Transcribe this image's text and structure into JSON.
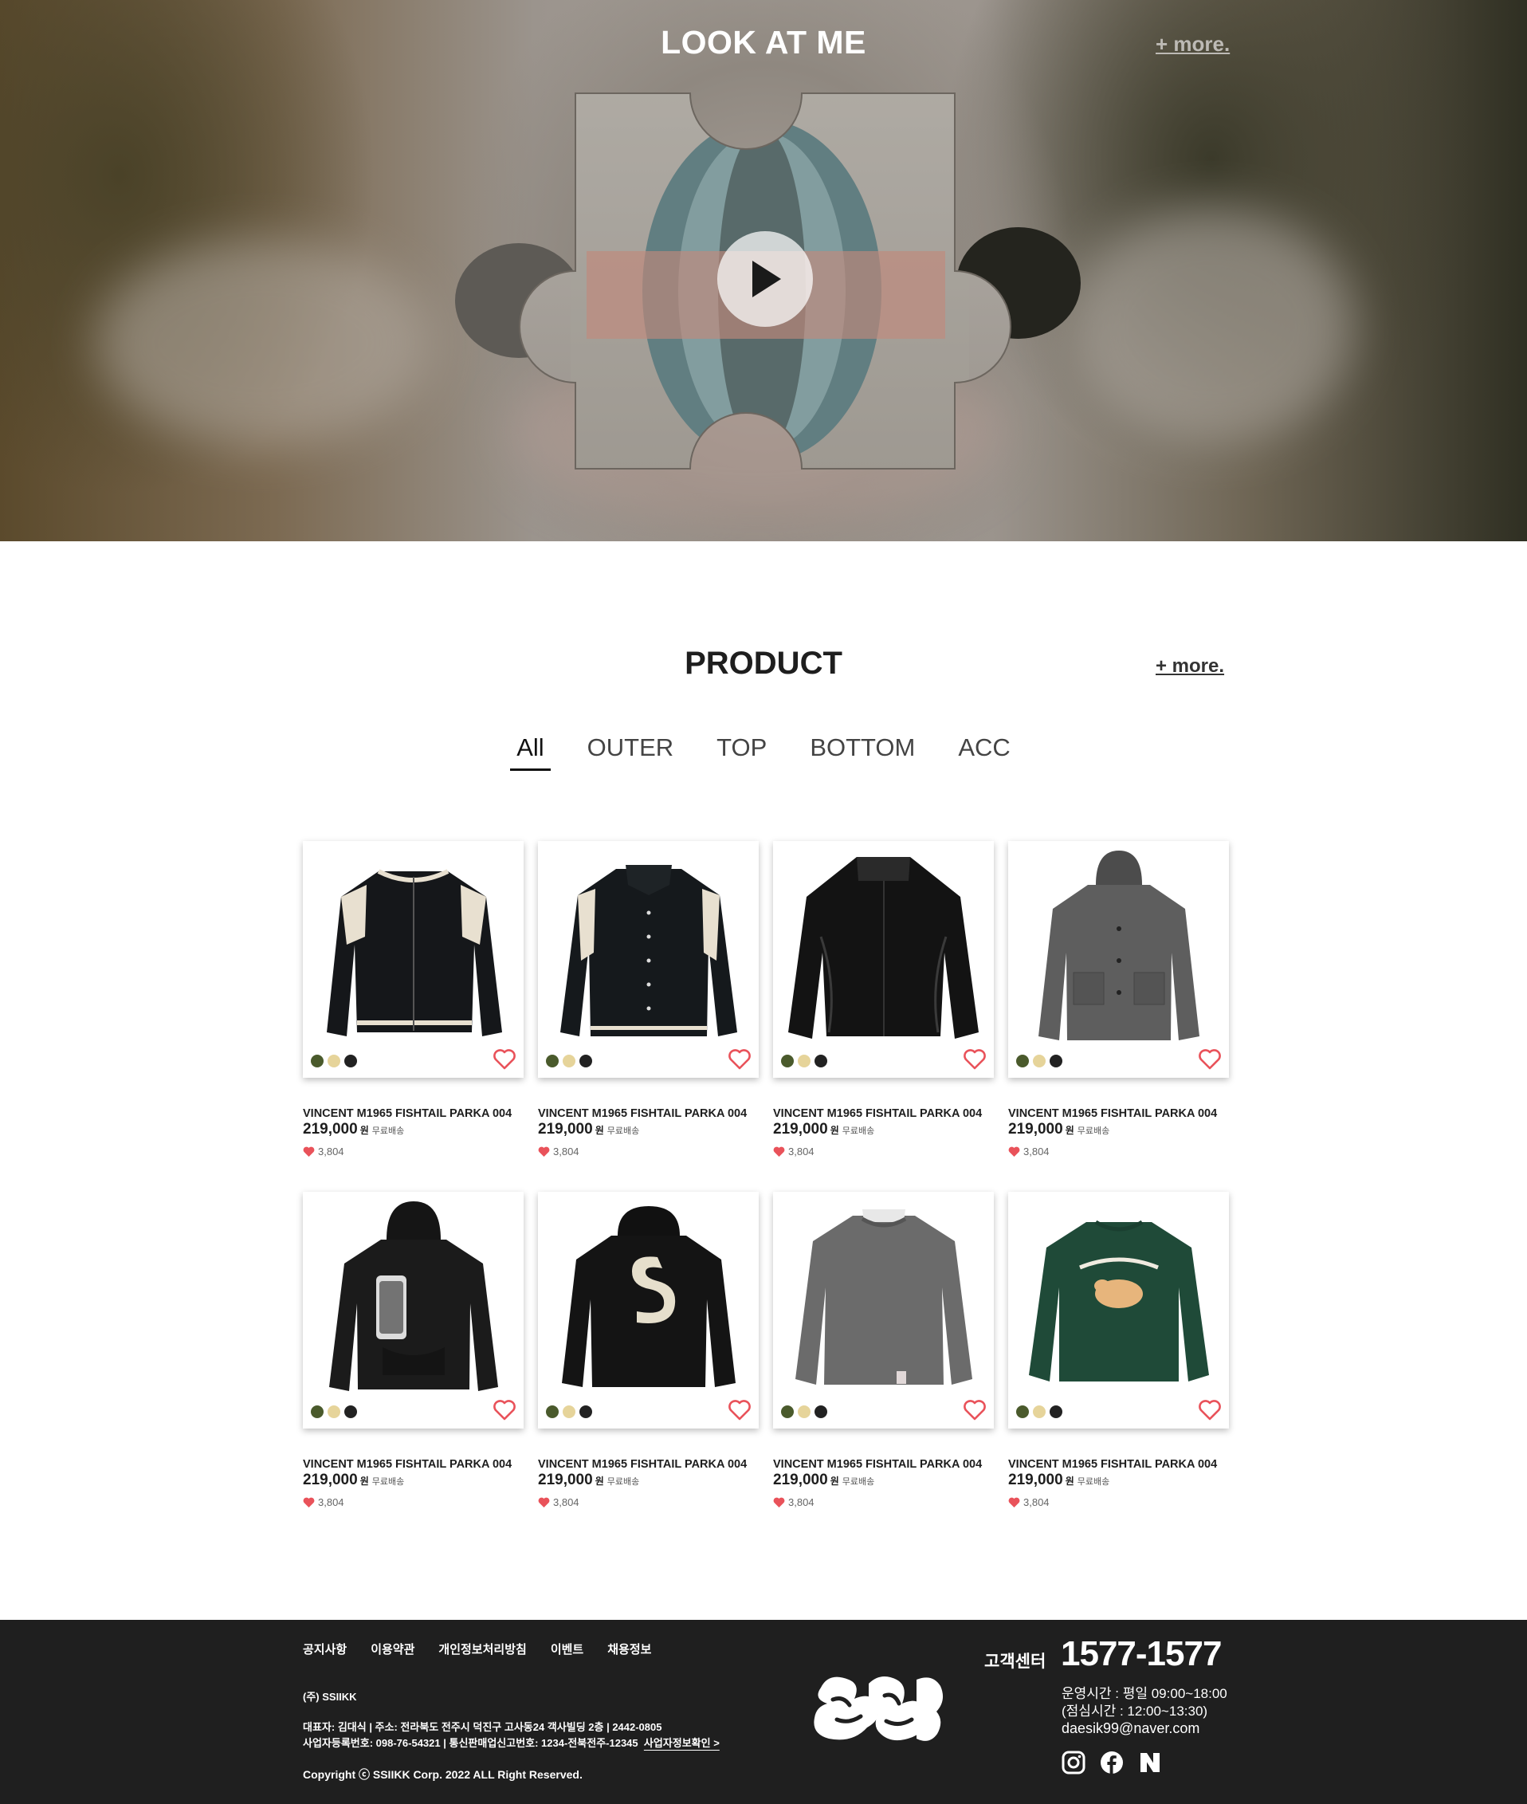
{
  "hero": {
    "title": "LOOK AT ME",
    "more_label": "+ more.",
    "play_icon": "play-icon"
  },
  "product_section": {
    "title": "PRODUCT",
    "more_label": "+ more.",
    "tabs": [
      {
        "label": "All",
        "active": true
      },
      {
        "label": "OUTER",
        "active": false
      },
      {
        "label": "TOP",
        "active": false
      },
      {
        "label": "BOTTOM",
        "active": false
      },
      {
        "label": "ACC",
        "active": false
      }
    ],
    "products": [
      {
        "name": "VINCENT M1965 FISHTAIL PARKA 004",
        "price": "219,000",
        "currency": "원",
        "shipping": "무료배송",
        "likes": "3,804",
        "image": "varsity-jacket-black-cream"
      },
      {
        "name": "VINCENT M1965 FISHTAIL PARKA 004",
        "price": "219,000",
        "currency": "원",
        "shipping": "무료배송",
        "likes": "3,804",
        "image": "varsity-jacket-collar"
      },
      {
        "name": "VINCENT M1965 FISHTAIL PARKA 004",
        "price": "219,000",
        "currency": "원",
        "shipping": "무료배송",
        "likes": "3,804",
        "image": "leather-jacket"
      },
      {
        "name": "VINCENT M1965 FISHTAIL PARKA 004",
        "price": "219,000",
        "currency": "원",
        "shipping": "무료배송",
        "likes": "3,804",
        "image": "grey-hooded-coat"
      },
      {
        "name": "VINCENT M1965 FISHTAIL PARKA 004",
        "price": "219,000",
        "currency": "원",
        "shipping": "무료배송",
        "likes": "3,804",
        "image": "black-zip-hoodie"
      },
      {
        "name": "VINCENT M1965 FISHTAIL PARKA 004",
        "price": "219,000",
        "currency": "원",
        "shipping": "무료배송",
        "likes": "3,804",
        "image": "black-s-hoodie"
      },
      {
        "name": "VINCENT M1965 FISHTAIL PARKA 004",
        "price": "219,000",
        "currency": "원",
        "shipping": "무료배송",
        "likes": "3,804",
        "image": "grey-sweater"
      },
      {
        "name": "VINCENT M1965 FISHTAIL PARKA 004",
        "price": "219,000",
        "currency": "원",
        "shipping": "무료배송",
        "likes": "3,804",
        "image": "green-retriever-sweatshirt"
      }
    ],
    "swatch_colors": [
      "#4a5a2c",
      "#e6d49a",
      "#222222"
    ],
    "heart_color": "#e9525a"
  },
  "footer": {
    "links": [
      "공지사항",
      "이용약관",
      "개인정보처리방침",
      "이벤트",
      "채용정보"
    ],
    "company": "(주) SSIIKK",
    "info_line1": "대표자: 김대식  |  주소: 전라북도 전주시 덕진구 고사동24 객사빌딩 2층  |  2442-0805",
    "info_line2": "사업자등록번호: 098-76-54321  |  통신판매업신고번호: 1234-전북전주-12345",
    "info_link": "사업자정보확인 >",
    "copyright": "Copyright ⓒ SSIIKK Corp. 2022 ALL Right Reserved.",
    "cs_label": "고객센터",
    "cs_phone": "1577-1577",
    "hours1": "운영시간 : 평일 09:00~18:00",
    "hours2": "(점심시간 : 12:00~13:30)",
    "email": "daesik99@naver.com",
    "social": [
      "instagram-icon",
      "facebook-icon",
      "naver-icon"
    ]
  }
}
